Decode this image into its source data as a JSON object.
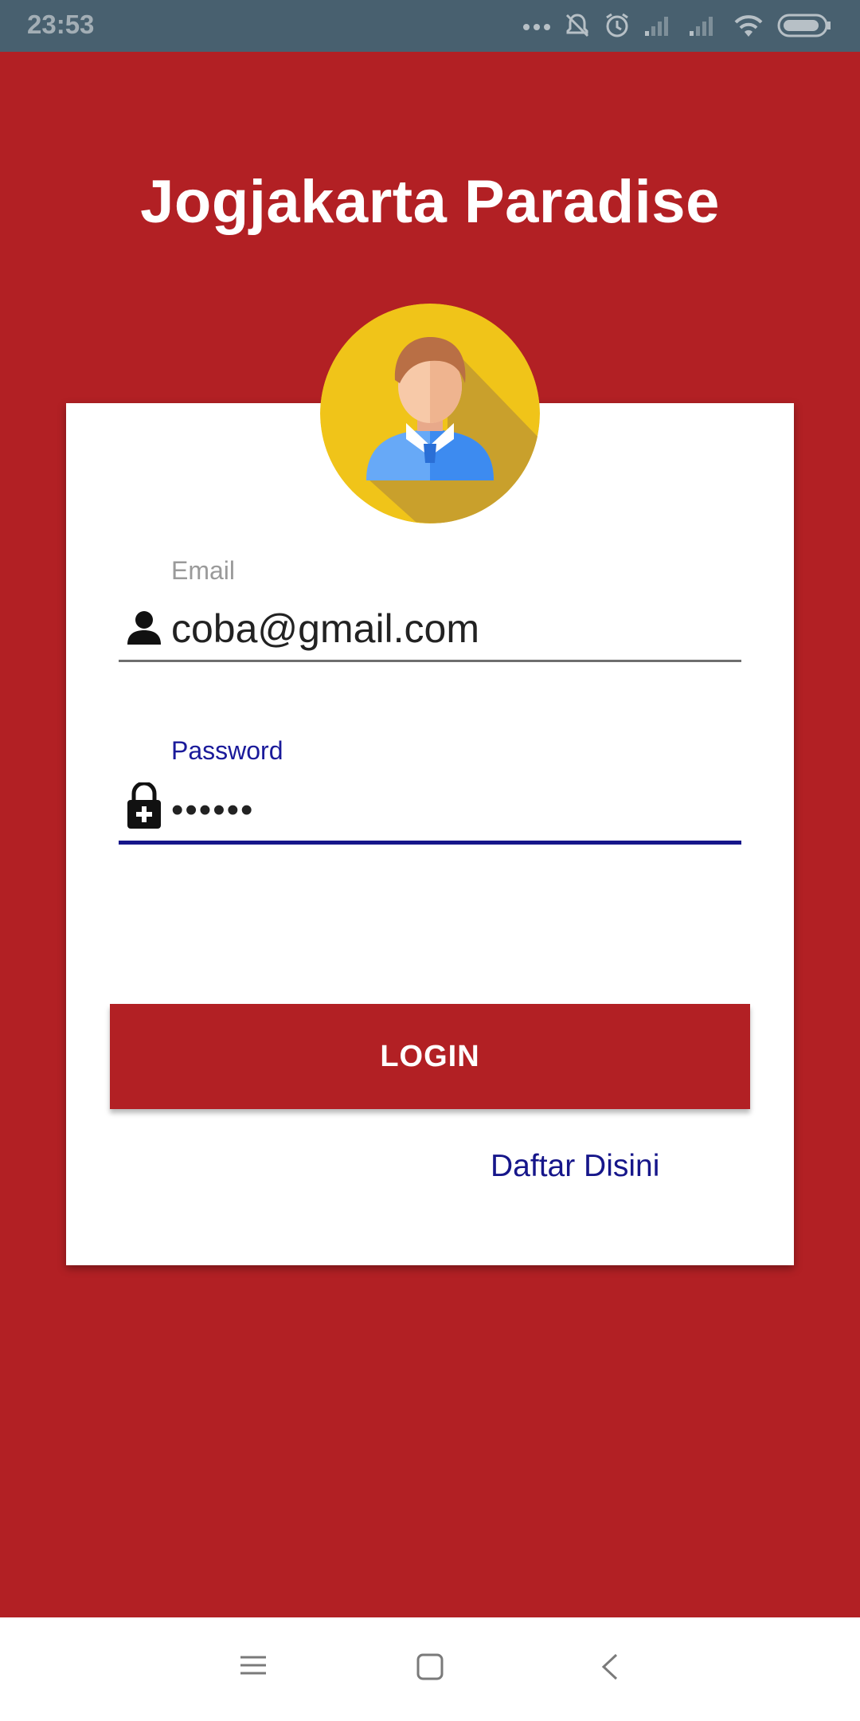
{
  "status_bar": {
    "time": "23:53",
    "icons": [
      "more-dots-icon",
      "silent-icon",
      "alarm-icon",
      "signal-icon",
      "signal-icon",
      "wifi-icon",
      "battery-icon"
    ]
  },
  "app": {
    "title": "Jogjakarta Paradise"
  },
  "login_form": {
    "avatar_icon": "user-avatar-icon",
    "email": {
      "label": "Email",
      "value": "coba@gmail.com",
      "icon": "person-icon"
    },
    "password": {
      "label": "Password",
      "value": "••••••",
      "icon": "lock-plus-icon"
    },
    "login_label": "LOGIN",
    "register_label": "Daftar Disini"
  },
  "nav_bar": {
    "buttons": [
      "menu-icon",
      "home-square-icon",
      "back-chevron-icon"
    ]
  },
  "colors": {
    "primary": "#b22024",
    "status_bar": "#48606f",
    "accent_text": "#16168a",
    "card": "#ffffff"
  }
}
